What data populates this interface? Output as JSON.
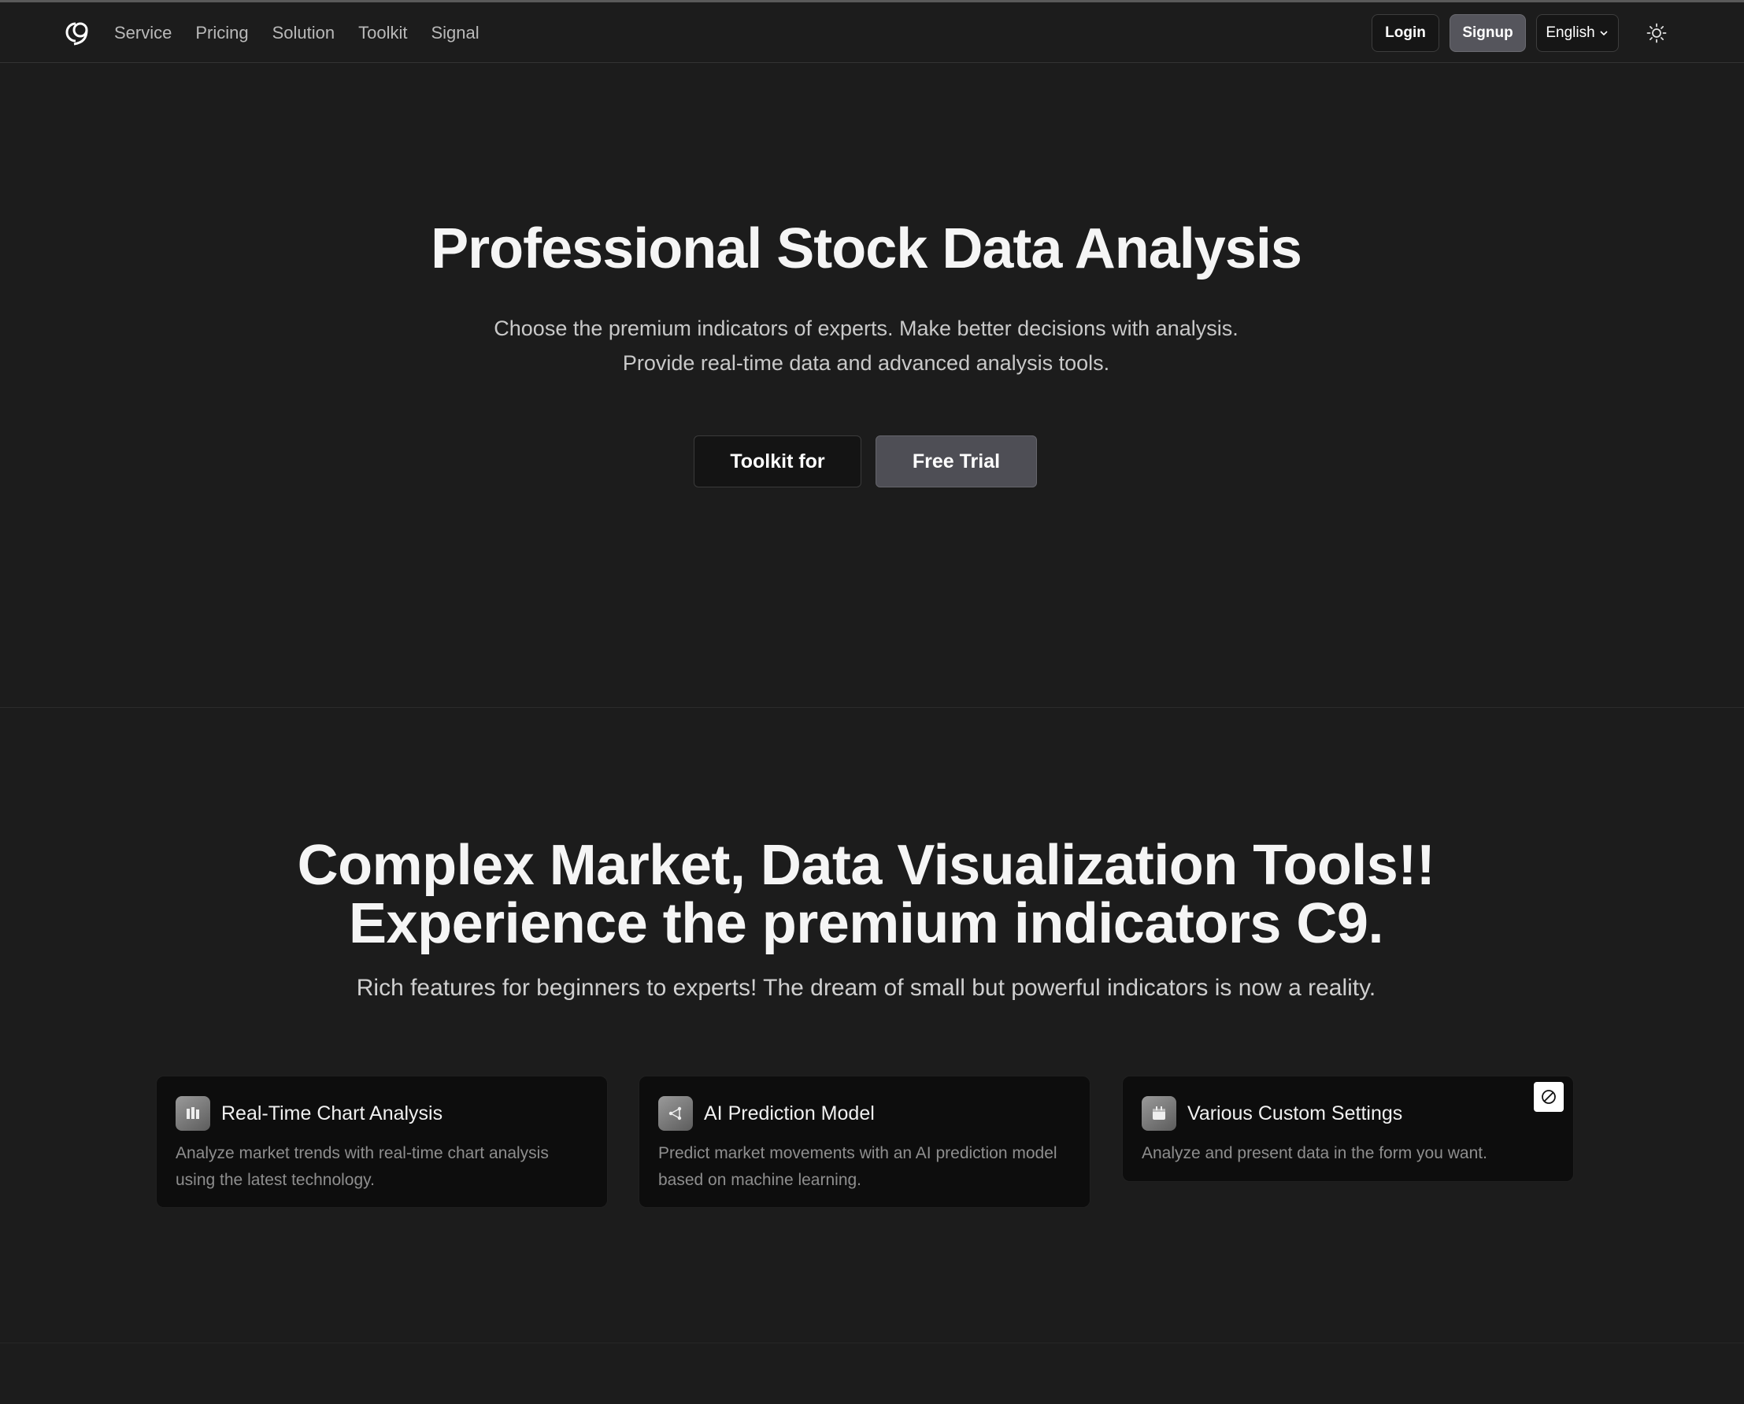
{
  "nav": {
    "links": [
      "Service",
      "Pricing",
      "Solution",
      "Toolkit",
      "Signal"
    ],
    "login": "Login",
    "signup": "Signup",
    "language": "English"
  },
  "hero": {
    "title": "Professional Stock Data Analysis",
    "subtitle": "Choose the premium indicators of experts. Make better decisions with analysis. Provide real-time data and advanced analysis tools.",
    "primary_button": "Toolkit for",
    "secondary_button": "Free Trial"
  },
  "features": {
    "title_line1": "Complex Market, Data Visualization Tools!!",
    "title_line2": "Experience the premium indicators C9.",
    "subtitle": "Rich features for beginners to experts! The dream of small but powerful indicators is now a reality.",
    "cards": [
      {
        "icon": "chart-bars-icon",
        "title": "Real-Time Chart Analysis",
        "desc": "Analyze market trends with real-time chart analysis using the latest technology."
      },
      {
        "icon": "network-icon",
        "title": "AI Prediction Model",
        "desc": "Predict market movements with an AI prediction model based on machine learning."
      },
      {
        "icon": "calendar-icon",
        "title": "Various Custom Settings",
        "desc": "Analyze and present data in the form you want."
      }
    ]
  },
  "colors": {
    "background": "#1c1c1c",
    "card": "#0d0d0d",
    "button_accent": "#4e4e55"
  }
}
